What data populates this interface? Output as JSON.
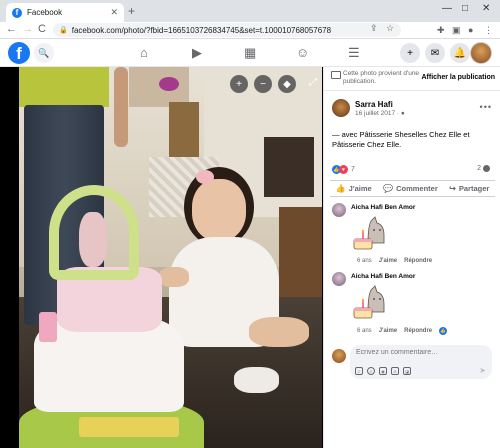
{
  "browser": {
    "tab_title": "Facebook",
    "tab_close": "✕",
    "new_tab": "+",
    "url": "facebook.com/photo/?fbid=1665103726834745&set=t.100010768057678",
    "back": "←",
    "forward": "→",
    "reload": "C",
    "minimize": "—",
    "maximize": "□",
    "close": "✕"
  },
  "fb": {
    "logo": "f",
    "notifications_badge": ""
  },
  "viewer": {
    "zoom_in": "+",
    "zoom_out": "−",
    "tag": "◆",
    "fullscreen": "⤢"
  },
  "panel": {
    "info_text": "Cette photo provient d'une publication.",
    "info_button": "Afficher la publication",
    "poster_name": "Sarra Hafi",
    "poster_date": "16 juillet 2017 · ",
    "caption": "— avec Pâtisserie Sheselles Chez Elle et Pâtisserie Chez Elle.",
    "reaction_count": "7",
    "comment_count": "2",
    "actions": {
      "like": "J'aime",
      "comment": "Commenter",
      "share": "Partager"
    },
    "comments": [
      {
        "author": "Aicha Hafi Ben Amor",
        "age": "6 ans",
        "like": "J'aime",
        "reply": "Répondre"
      },
      {
        "author": "Aicha Hafi Ben Amor",
        "age": "6 ans",
        "like": "J'aime",
        "reply": "Répondre"
      }
    ],
    "write_placeholder": "Écrivez un commentaire…"
  },
  "colors": {
    "fb_blue": "#1877f2",
    "love_red": "#f33e58",
    "panel_bg": "#ffffff",
    "viewer_bg": "#000000"
  }
}
